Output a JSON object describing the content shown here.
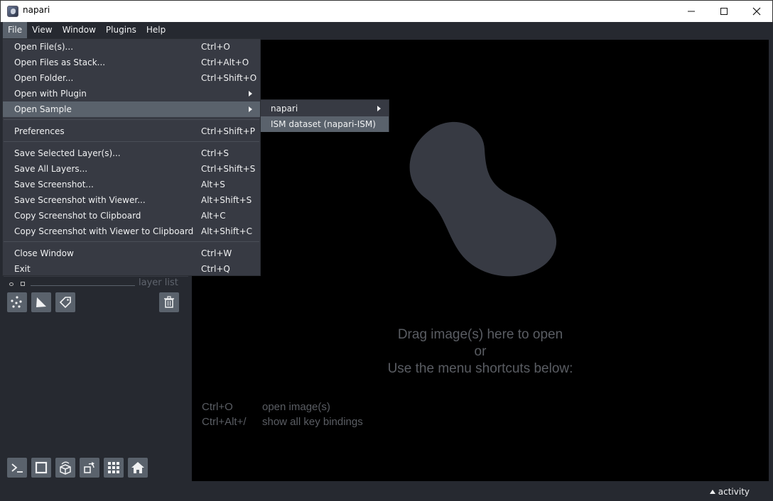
{
  "window": {
    "title": "napari"
  },
  "menubar": {
    "items": [
      "File",
      "View",
      "Window",
      "Plugins",
      "Help"
    ]
  },
  "file_menu": {
    "items": [
      {
        "label": "Open File(s)...",
        "shortcut": "Ctrl+O"
      },
      {
        "label": "Open Files as Stack...",
        "shortcut": "Ctrl+Alt+O"
      },
      {
        "label": "Open Folder...",
        "shortcut": "Ctrl+Shift+O"
      },
      {
        "label": "Open with Plugin",
        "shortcut": ""
      },
      {
        "label": "Open Sample",
        "shortcut": ""
      },
      {
        "label": "Preferences",
        "shortcut": "Ctrl+Shift+P"
      },
      {
        "label": "Save Selected Layer(s)...",
        "shortcut": "Ctrl+S"
      },
      {
        "label": "Save All Layers...",
        "shortcut": "Ctrl+Shift+S"
      },
      {
        "label": "Save Screenshot...",
        "shortcut": "Alt+S"
      },
      {
        "label": "Save Screenshot with Viewer...",
        "shortcut": "Alt+Shift+S"
      },
      {
        "label": "Copy Screenshot to Clipboard",
        "shortcut": "Alt+C"
      },
      {
        "label": "Copy Screenshot with Viewer to Clipboard",
        "shortcut": "Alt+Shift+C"
      },
      {
        "label": "Close Window",
        "shortcut": "Ctrl+W"
      },
      {
        "label": "Exit",
        "shortcut": "Ctrl+Q"
      }
    ]
  },
  "sample_submenu": {
    "items": [
      {
        "label": "napari"
      },
      {
        "label": "ISM dataset (napari-ISM)"
      }
    ]
  },
  "layer_list": {
    "label": "layer list"
  },
  "welcome": {
    "line1": "Drag image(s) here to open",
    "line2": "or",
    "line3": "Use the menu shortcuts below:",
    "shortcuts": [
      {
        "key": "Ctrl+O",
        "desc": "open image(s)"
      },
      {
        "key": "Ctrl+Alt+/",
        "desc": "show all key bindings"
      }
    ]
  },
  "statusbar": {
    "activity": "activity"
  },
  "colors": {
    "background": "#262930",
    "panel": "#373a43",
    "highlight": "#5a626c",
    "canvas": "#000000",
    "text": "#f0f1f2"
  }
}
